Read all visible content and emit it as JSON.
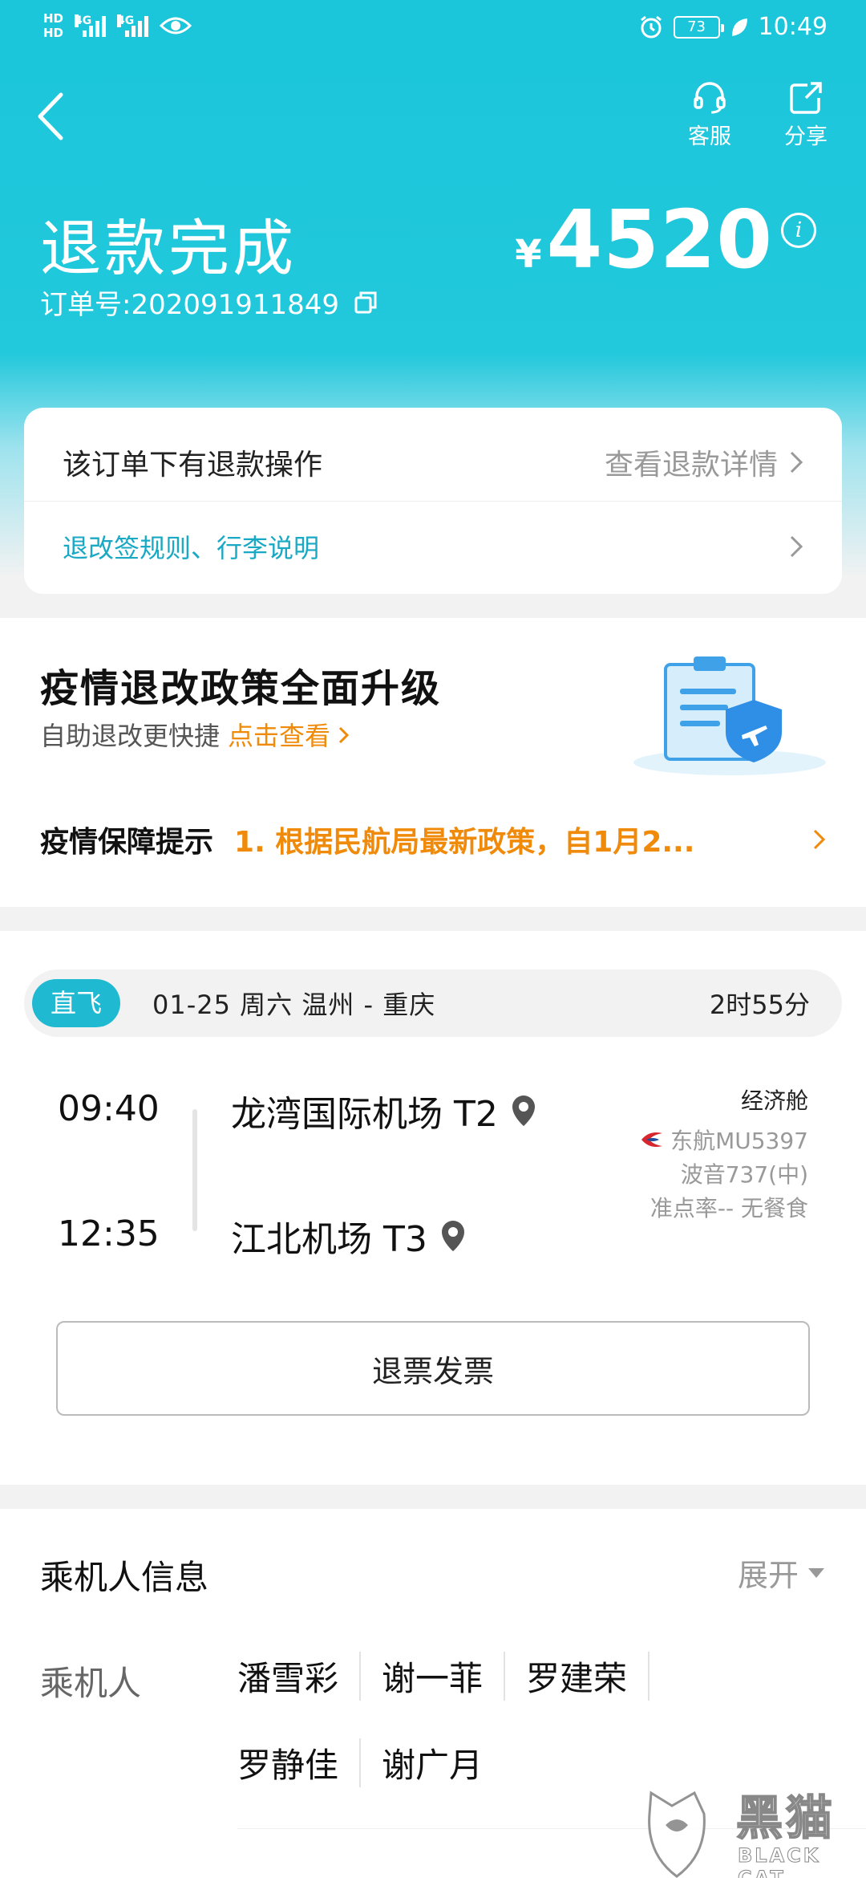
{
  "status_bar": {
    "hd1": "HD",
    "hd2": "HD",
    "network1": "4G",
    "network2": "4G",
    "battery": "73",
    "time": "10:49"
  },
  "nav": {
    "service_label": "客服",
    "share_label": "分享"
  },
  "order": {
    "status": "退款完成",
    "order_number": "订单号:202091911849",
    "currency": "¥",
    "amount": "4520"
  },
  "refund_card": {
    "notice": "该订单下有退款操作",
    "detail_link": "查看退款详情",
    "rules_link": "退改签规则、行李说明"
  },
  "policy": {
    "title": "疫情退改政策全面升级",
    "subtitle": "自助退改更快捷",
    "view_link": "点击查看",
    "tip_label": "疫情保障提示",
    "tip_text": "1. 根据民航局最新政策，自1月2..."
  },
  "flight": {
    "type_tag": "直飞",
    "date": "01-25  周六  温州 - 重庆",
    "duration": "2时55分",
    "depart_time": "09:40",
    "depart_airport": "龙湾国际机场 T2",
    "arrive_time": "12:35",
    "arrive_airport": "江北机场 T3",
    "cabin": "经济舱",
    "airline_flight": "东航MU5397",
    "aircraft": "波音737(中)",
    "ontime_meal": "准点率-- 无餐食",
    "invoice_button": "退票发票"
  },
  "passengers": {
    "section_title": "乘机人信息",
    "toggle_label": "展开",
    "label": "乘机人",
    "names": [
      "潘雪彩",
      "谢一菲",
      "罗建荣",
      "罗静佳",
      "谢广月"
    ]
  },
  "watermark": {
    "name": "黑猫",
    "sub": "BLACK CAT"
  },
  "colors": {
    "brand_teal": "#1bc6da",
    "link_orange": "#f08a0a",
    "link_blue": "#1aa9c4"
  }
}
